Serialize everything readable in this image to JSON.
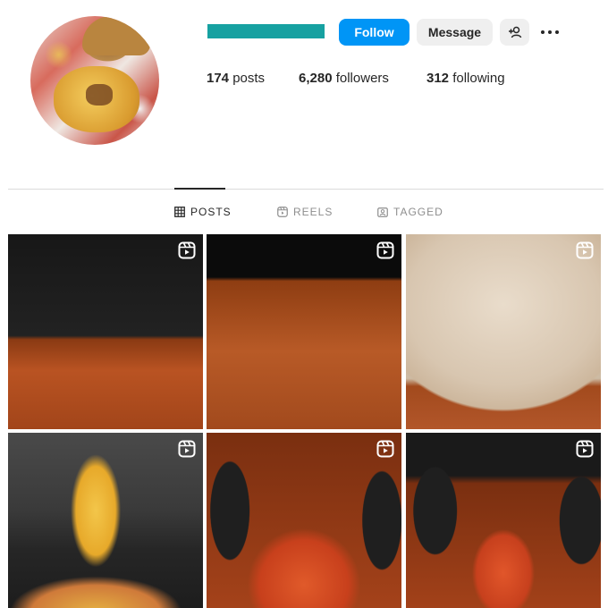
{
  "profile": {
    "buttons": {
      "follow": "Follow",
      "message": "Message"
    },
    "stats": {
      "posts_count": "174",
      "posts_label": "posts",
      "followers_count": "6,280",
      "followers_label": "followers",
      "following_count": "312",
      "following_label": "following"
    }
  },
  "tabs": [
    {
      "label": "POSTS",
      "icon": "grid-icon",
      "active": true
    },
    {
      "label": "REELS",
      "icon": "reels-icon",
      "active": false
    },
    {
      "label": "TAGGED",
      "icon": "tagged-icon",
      "active": false
    }
  ],
  "grid": {
    "tiles": [
      {
        "type": "reel",
        "icon": "reels-icon"
      },
      {
        "type": "reel",
        "icon": "reels-icon"
      },
      {
        "type": "reel",
        "icon": "reels-icon"
      },
      {
        "type": "reel",
        "icon": "reels-icon"
      },
      {
        "type": "reel",
        "icon": "reels-icon"
      },
      {
        "type": "reel",
        "icon": "reels-icon"
      }
    ]
  },
  "colors": {
    "follow_button": "#0095f6",
    "secondary_button": "#efefef",
    "username_redaction": "#16a1a1",
    "text_primary": "#262626",
    "text_secondary": "#8e8e8e",
    "divider": "#dbdbdb"
  }
}
